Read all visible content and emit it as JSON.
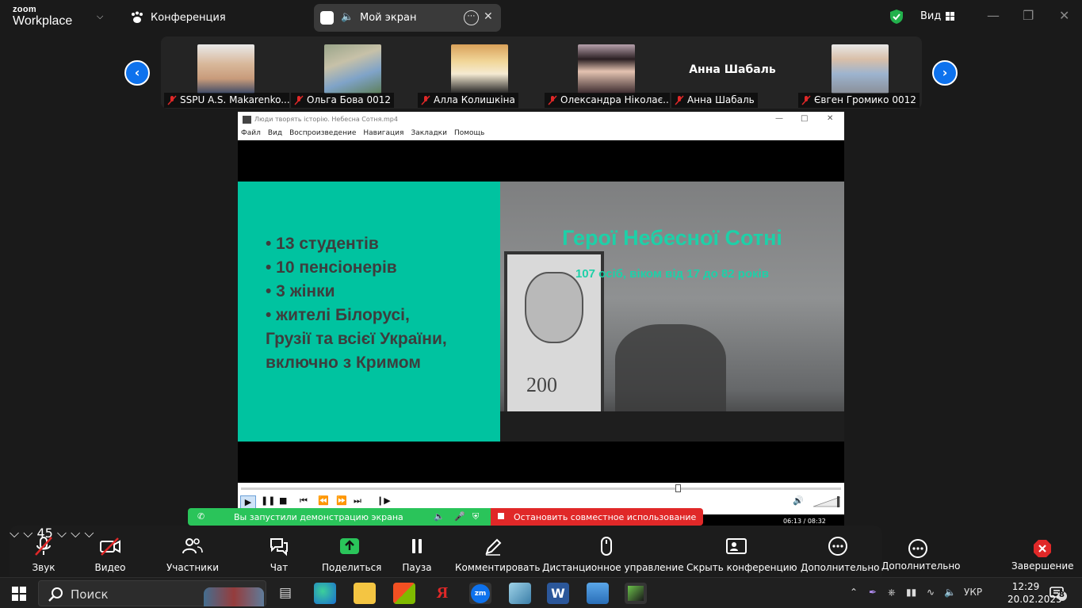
{
  "app": {
    "logo_top": "zoom",
    "logo_bottom": "Workplace",
    "conference_label": "Конференция",
    "share_pill_label": "Мой экран",
    "view_label": "Вид"
  },
  "participants": [
    {
      "name": "SSPU A.S. Makarenko..."
    },
    {
      "name": "Ольга Бова 0012"
    },
    {
      "name": "Алла Колишкіна"
    },
    {
      "name": "Олександра Ніколає..."
    },
    {
      "name": "Анна Шабаль",
      "display_name": "Анна Шабаль"
    },
    {
      "name": "Євген Громико 0012"
    }
  ],
  "player": {
    "title": "Люди творять історію. Небесна Сотня.mp4",
    "menu": [
      "Файл",
      "Вид",
      "Воспроизведение",
      "Навигация",
      "Закладки",
      "Помощь"
    ],
    "time": "06:13 / 08:32",
    "progress": 0.73,
    "slide": {
      "bullets": [
        "• 13 студентів",
        "• 10 пенсіонерів",
        "• 3 жінки",
        "• жителі Білорусі,",
        "Грузії та всієї України,",
        "включно з Кримом"
      ],
      "title": "Герої Небесної Сотні",
      "subtitle": "107 осіб, віком від 17 до 82 років",
      "poster_number": "200"
    }
  },
  "share_bar": {
    "message": "Вы запустили демонстрацию экрана",
    "stop_label": "Остановить совместное использование"
  },
  "toolbar": {
    "audio": "Звук",
    "video": "Видео",
    "participants": "Участники",
    "participants_count": "45",
    "chat": "Чат",
    "share": "Поделиться",
    "pause": "Пауза",
    "annotate": "Комментировать",
    "remote": "Дистанционное управление",
    "hide": "Скрыть конференцию",
    "more": "Дополнительно",
    "more2": "Дополнительно",
    "end": "Завершение"
  },
  "taskbar": {
    "search_label": "Поиск",
    "language": "УКР",
    "time": "12:29",
    "date": "20.02.2025",
    "notifications": "8"
  },
  "colors": {
    "accent_blue": "#0e72ed",
    "share_green": "#2ac45a",
    "stop_red": "#e02828",
    "slide_teal": "#00c3a0"
  }
}
